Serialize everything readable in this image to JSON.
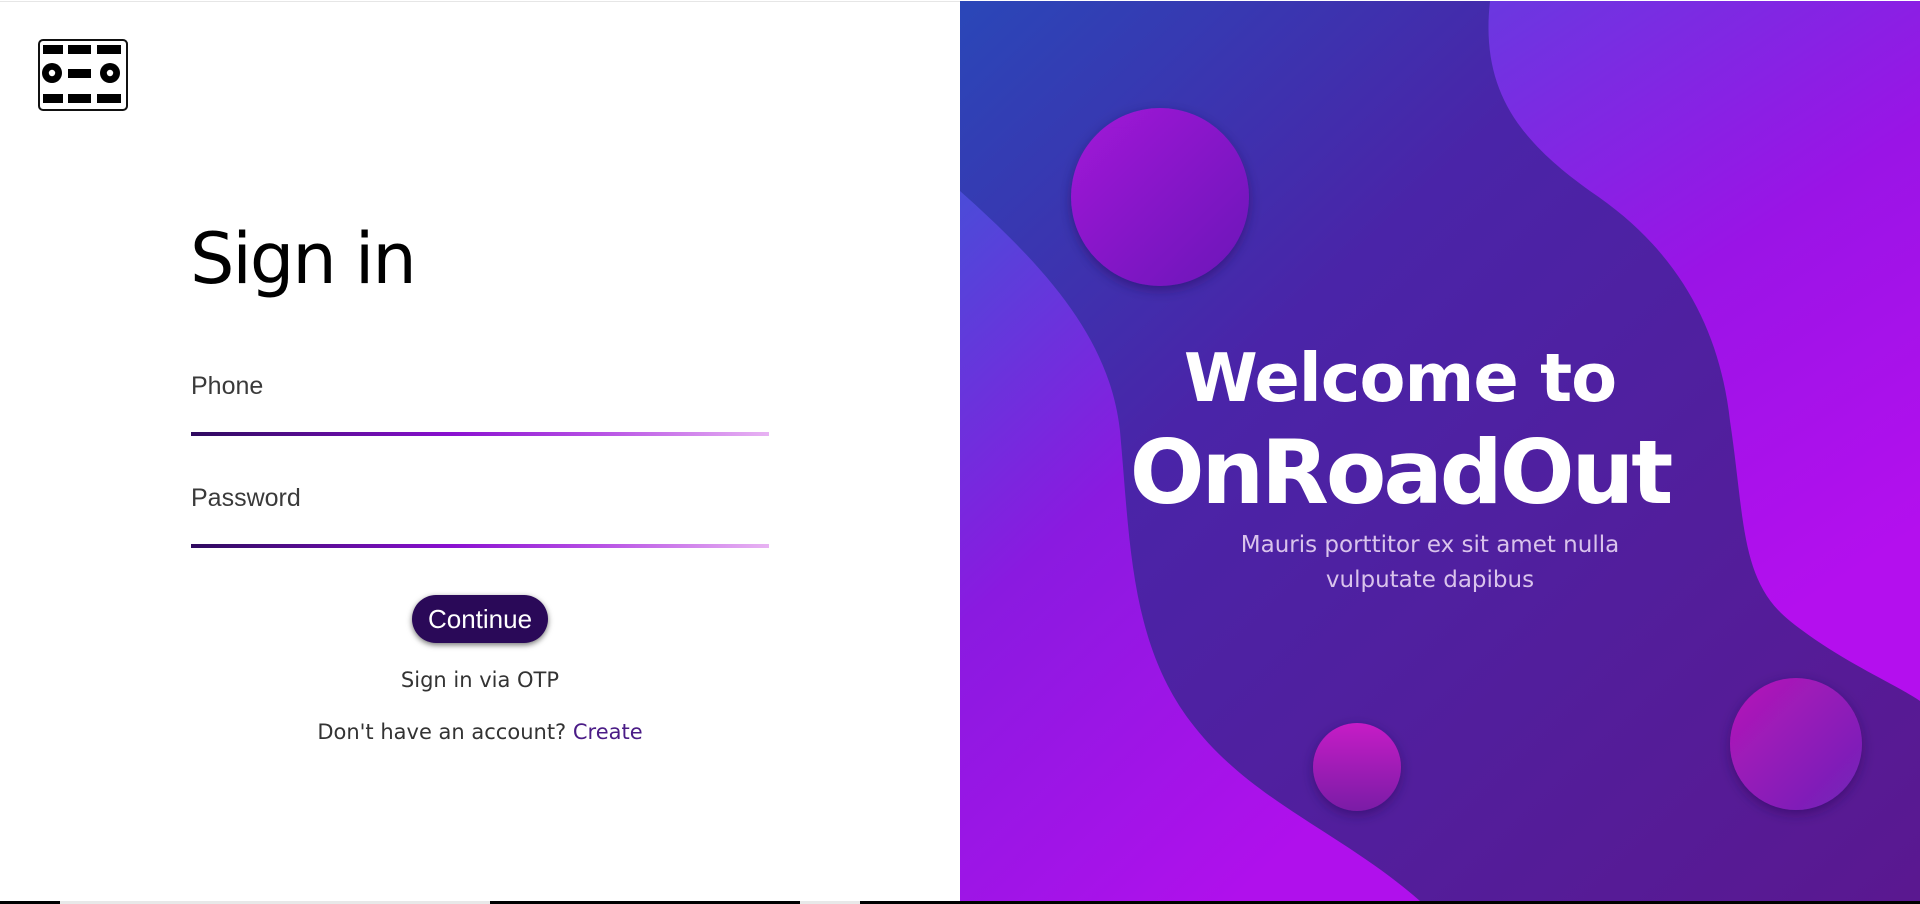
{
  "form": {
    "title": "Sign in",
    "phone_placeholder": "Phone",
    "password_placeholder": "Password",
    "continue_label": "Continue",
    "otp_link": "Sign in via OTP",
    "no_account_text": "Don't have an account?",
    "create_link": "Create"
  },
  "hero": {
    "welcome": "Welcome to",
    "brand": "OnRoadOut",
    "tagline": "Mauris porttitor ex sit amet nulla vulputate dapibus"
  },
  "icons": {
    "logo": "logo-icon"
  },
  "colors": {
    "button": "#2a0958",
    "underline_start": "#2e0a5e",
    "underline_mid": "#8a10d0",
    "underline_end": "#e8b3f3",
    "create_link": "#4a1b86",
    "hero_dark": "#4e1a8e",
    "hero_magenta": "#b012ec"
  }
}
